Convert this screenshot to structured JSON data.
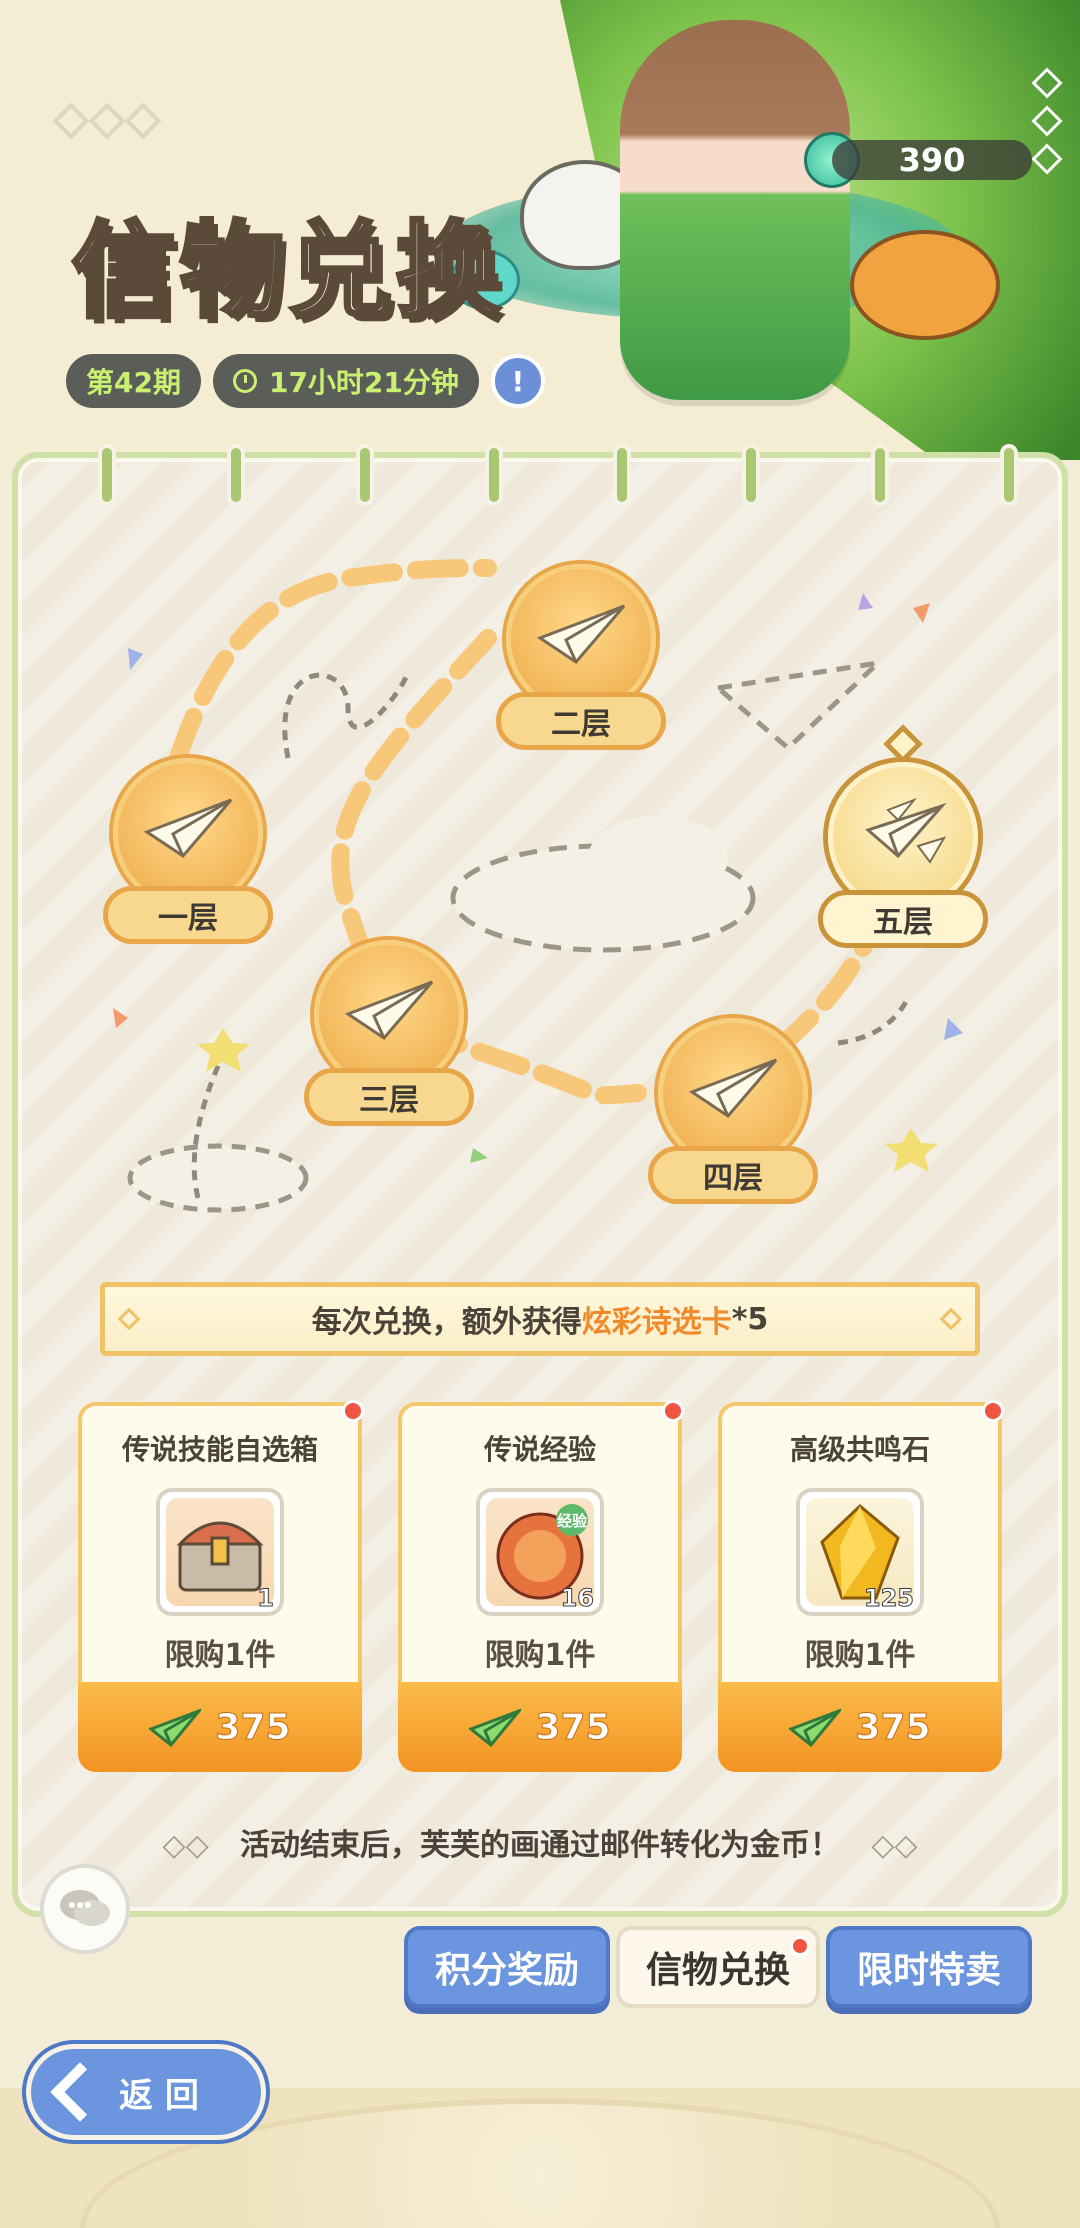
{
  "header": {
    "title": "信物兑换",
    "period": "第42期",
    "time_left": "17小时21分钟",
    "info_label": "!",
    "currency_value": "390"
  },
  "floors": [
    {
      "label": "一层"
    },
    {
      "label": "二层"
    },
    {
      "label": "三层"
    },
    {
      "label": "四层"
    },
    {
      "label": "五层"
    }
  ],
  "banner": {
    "prefix": "每次兑换，额外获得",
    "highlight": "炫彩诗选卡",
    "suffix": "*5"
  },
  "cards": [
    {
      "name": "传说技能自选箱",
      "qty": "1",
      "limit": "限购1件",
      "price": "375",
      "icon": "treasure-chest"
    },
    {
      "name": "传说经验",
      "qty": "16",
      "limit": "限购1件",
      "price": "375",
      "icon": "exp-orb",
      "badge": "经验"
    },
    {
      "name": "高级共鸣石",
      "qty": "125",
      "limit": "限购1件",
      "price": "375",
      "icon": "yellow-gem"
    }
  ],
  "footnote": "活动结束后，芙芙的画通过邮件转化为金币！",
  "tabs": [
    {
      "label": "积分奖励"
    },
    {
      "label": "信物兑换"
    },
    {
      "label": "限时特卖"
    }
  ],
  "back_label": "返 回",
  "colors": {
    "accent_orange": "#f29423",
    "highlight_text": "#f08a2a",
    "tab_blue": "#6b95df",
    "panel_border": "#cfe0a9",
    "badge_red": "#f05540"
  }
}
